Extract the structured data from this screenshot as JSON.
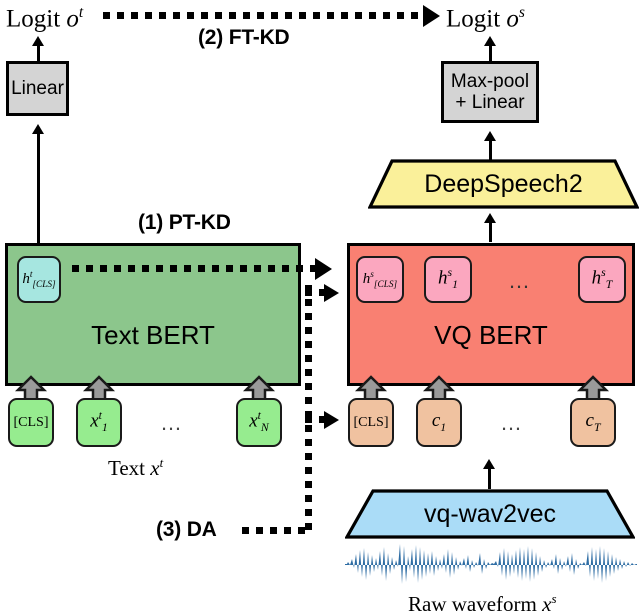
{
  "figure": {
    "type": "architecture-diagram",
    "title": "Knowledge distillation from Text BERT to VQ BERT",
    "accent_colors": {
      "text_bert": "#8cc68c",
      "vq_bert": "#f98072",
      "deepspeech2": "#faf09a",
      "vq_wav2vec": "#aadcf7",
      "gray_box": "#d4d4d4",
      "token_green": "#96ec8f",
      "token_pink": "#fba7bf",
      "token_cyan": "#a6e6e0",
      "token_peach": "#f0c2a0",
      "waveform": "#2e6da4"
    }
  },
  "steps": [
    {
      "id": "pt-kd",
      "label": "(1) PT-KD"
    },
    {
      "id": "ft-kd",
      "label": "(2) FT-KD"
    },
    {
      "id": "da",
      "label": "(3) DA"
    }
  ],
  "teacher": {
    "logit": {
      "base": "Logit",
      "symbol": "o",
      "superscript": "t"
    },
    "head_box": "Linear",
    "encoder": "Text BERT",
    "cls_hidden": {
      "symbol": "h",
      "superscript": "t",
      "subscript": "[CLS]"
    },
    "input_caption": {
      "base": "Text",
      "symbol": "x",
      "superscript": "t"
    },
    "tokens": [
      {
        "symbol": "[CLS]",
        "subscript": "",
        "superscript": ""
      },
      {
        "symbol": "x",
        "subscript": "1",
        "superscript": "t"
      },
      {
        "symbol": "…",
        "subscript": "",
        "superscript": ""
      },
      {
        "symbol": "x",
        "subscript": "N",
        "superscript": "t"
      }
    ]
  },
  "student": {
    "logit": {
      "base": "Logit",
      "symbol": "o",
      "superscript": "s"
    },
    "head_box_line1": "Max-pool",
    "head_box_line2": "+ Linear",
    "acoustic_model": "DeepSpeech2",
    "encoder": "VQ BERT",
    "hidden_states": [
      {
        "symbol": "h",
        "superscript": "s",
        "subscript": "[CLS]"
      },
      {
        "symbol": "h",
        "superscript": "s",
        "subscript": "1"
      },
      {
        "symbol": "…",
        "superscript": "",
        "subscript": ""
      },
      {
        "symbol": "h",
        "superscript": "s",
        "subscript": "T"
      }
    ],
    "tokens": [
      {
        "symbol": "[CLS]",
        "subscript": "",
        "superscript": ""
      },
      {
        "symbol": "c",
        "subscript": "1",
        "superscript": ""
      },
      {
        "symbol": "…",
        "subscript": "",
        "superscript": ""
      },
      {
        "symbol": "c",
        "subscript": "T",
        "superscript": ""
      }
    ],
    "quantizer": "vq-wav2vec",
    "input_caption": {
      "base": "Raw waveform",
      "symbol": "x",
      "superscript": "s"
    }
  }
}
